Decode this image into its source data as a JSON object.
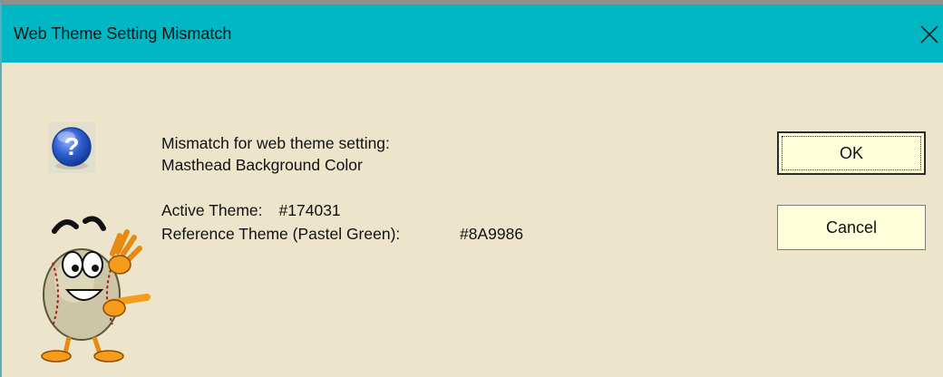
{
  "dialog": {
    "title": "Web Theme Setting Mismatch",
    "close_glyph": "✕",
    "icon": "question-mark-icon",
    "mascot": "baseball-mascot-pointing-icon",
    "message_line1": "Mismatch for web theme setting:",
    "message_line2": "Masthead Background Color",
    "active_theme_label": "Active Theme:",
    "active_theme_value": "#174031",
    "reference_theme_label": "Reference Theme (Pastel Green):",
    "reference_theme_value": "#8A9986",
    "ok_label": "OK",
    "cancel_label": "Cancel"
  },
  "colors": {
    "titlebar": "#00b7c3",
    "dialog_background": "#ece5cb",
    "button_background": "#ffffdb"
  }
}
